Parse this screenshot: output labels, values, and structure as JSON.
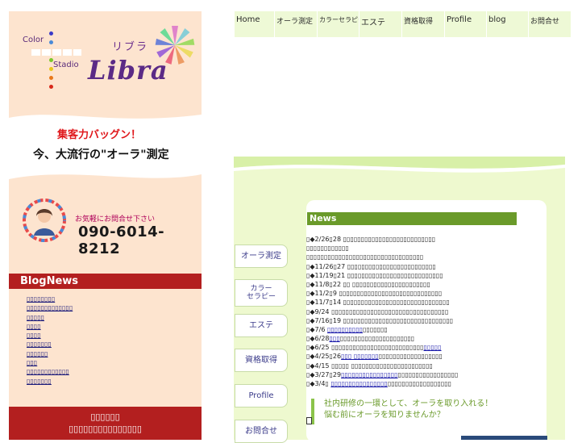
{
  "logo": {
    "color_word": "Color",
    "studio_word": "Stadio",
    "katakana": "リブラ",
    "name": "Libra"
  },
  "promo": {
    "line1": "集客力バッグン！",
    "line2": "今、大流行の\"オーラ\"測定"
  },
  "contact": {
    "text": "お気軽にお問合せ下さい",
    "phone": "090-6014-8212"
  },
  "blog": {
    "heading": "BlogNews",
    "items": [
      "▯▯▯▯▯▯▯▯",
      "▯▯▯▯▯▯▯▯▯▯▯▯▯",
      "▯▯▯▯▯",
      "▯▯▯▯",
      "▯▯▯▯",
      "▯▯▯▯▯▯▯",
      "▯▯▯▯▯▯",
      "▯▯▯",
      "▯▯▯▯▯▯▯▯▯▯▯▯",
      "▯▯▯▯▯▯▯"
    ],
    "footer_line1": "▯▯▯▯▯▯",
    "footer_line2": "▯▯▯▯▯▯▯▯▯▯▯▯▯▯▯"
  },
  "top_nav": [
    "Home",
    "オーラ測定",
    "カラーセラピー",
    "エステ",
    "資格取得",
    "Profile",
    "blog",
    "お問合せ"
  ],
  "side_nav": [
    "オーラ測定",
    "カラー\nセラピー",
    "エステ",
    "資格取得",
    "Profile",
    "お問合せ"
  ],
  "news": {
    "title": "News",
    "items": [
      {
        "pre": "▯◆2/26▯28 ",
        "link": "",
        "post": "▯▯▯▯▯▯▯▯▯▯▯▯▯▯▯▯▯▯▯▯▯▯▯▯▯▯"
      },
      {
        "pre": "▯▯▯▯▯▯▯▯▯▯▯▯",
        "link": "",
        "post": ""
      },
      {
        "pre": "▯▯▯▯▯▯▯▯▯▯▯▯▯▯▯▯▯▯▯▯▯▯▯▯▯▯▯▯▯▯▯▯▯",
        "link": "",
        "post": ""
      },
      {
        "pre": "▯◆11/26▯27 ",
        "link": "",
        "post": "▯▯▯▯▯▯▯▯▯▯▯▯▯▯▯▯▯▯▯▯▯▯▯▯▯"
      },
      {
        "pre": "▯◆11/19▯21 ",
        "link": "",
        "post": "▯▯▯▯▯▯▯▯▯▯▯▯▯▯▯▯▯▯▯▯▯▯▯▯▯▯▯"
      },
      {
        "pre": "▯◆11/8▯22 ▯▯ ",
        "link": "",
        "post": "▯▯▯▯▯▯▯▯▯▯▯▯▯▯▯▯▯▯▯▯▯▯"
      },
      {
        "pre": "▯◆11/2▯9 ",
        "link": "",
        "post": "▯▯▯▯▯▯▯▯▯▯▯▯▯▯▯▯▯▯▯▯▯▯▯▯▯▯▯▯▯"
      },
      {
        "pre": "▯◆11/7▯14 ",
        "link": "",
        "post": "▯▯▯▯▯▯▯▯▯▯▯▯▯▯▯▯▯▯▯▯▯▯▯▯▯▯▯▯▯▯"
      },
      {
        "pre": "▯◆9/24 ",
        "link": "",
        "post": "▯▯▯▯▯▯▯▯▯▯▯▯▯▯▯▯▯▯▯▯▯▯▯▯▯▯▯▯▯▯▯▯▯"
      },
      {
        "pre": "▯◆7/16▯19 ",
        "link": "",
        "post": "▯▯▯▯▯▯▯▯▯▯▯▯▯▯▯▯▯▯▯▯▯▯▯▯▯▯▯▯▯▯▯"
      },
      {
        "pre": "▯◆7/6 ",
        "link": "▯▯▯▯▯▯▯▯▯▯",
        "post": "▯▯▯▯▯▯▯"
      },
      {
        "pre": "▯◆6/28",
        "link": "▯▯▯",
        "post": "▯▯▯▯▯▯▯▯▯▯▯▯▯▯▯▯▯▯▯▯▯"
      },
      {
        "pre": "▯◆6/25 ",
        "link": "",
        "post": "▯▯▯▯▯▯▯▯▯▯▯▯▯▯▯▯▯▯▯▯▯▯▯▯▯▯",
        "link2": "▯▯▯▯▯"
      },
      {
        "pre": "▯◆4/25▯26",
        "link": "▯▯▯ ▯▯▯▯▯▯▯",
        "post": "▯▯▯▯▯▯▯▯▯▯▯▯▯▯▯▯▯▯"
      },
      {
        "pre": "▯◆4/15 ▯▯▯▯▯ ",
        "link": "",
        "post": "▯▯▯▯▯▯▯▯▯▯▯▯▯▯▯▯▯▯▯▯▯▯▯"
      },
      {
        "pre": "▯◆3/27▯29",
        "link": "▯▯▯▯▯▯▯▯▯▯▯▯▯▯▯▯",
        "post": "▯▯▯▯▯▯▯▯▯▯▯▯▯▯▯▯▯"
      },
      {
        "pre": "▯◆3/4▯ ",
        "link": "▯▯▯▯▯▯▯▯▯▯▯▯▯▯▯▯",
        "post": "▯▯▯▯▯▯▯▯▯▯▯▯▯▯▯▯▯▯"
      }
    ]
  },
  "banner": {
    "line1": "社内研修の一環として、オーラを取り入れる！",
    "line2": "悩む前にオーラを知りませんか？"
  },
  "colors": {
    "peach": "#fde4cf",
    "red": "#b31f1f",
    "green": "#6a9a2a",
    "lime": "#eef9cf",
    "purple": "#5b2a86"
  }
}
